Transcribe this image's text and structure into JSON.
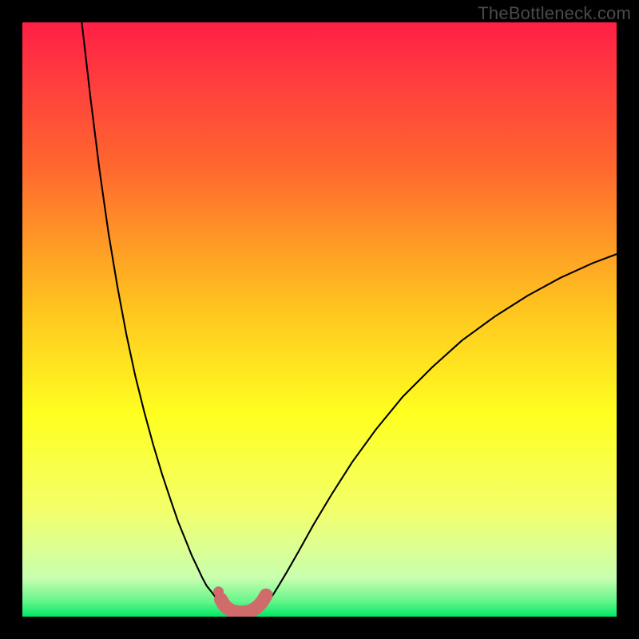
{
  "watermark": "TheBottleneck.com",
  "chart_data": {
    "type": "line",
    "title": "",
    "xlabel": "",
    "ylabel": "",
    "xlim": [
      0,
      100
    ],
    "ylim": [
      0,
      100
    ],
    "gradient_stops": [
      {
        "offset": 0.0,
        "color": "#ff1f47"
      },
      {
        "offset": 0.25,
        "color": "#ff6a2e"
      },
      {
        "offset": 0.48,
        "color": "#ffc41f"
      },
      {
        "offset": 0.66,
        "color": "#ffff20"
      },
      {
        "offset": 0.82,
        "color": "#f3ff6a"
      },
      {
        "offset": 0.935,
        "color": "#c9ffb0"
      },
      {
        "offset": 0.975,
        "color": "#63f58a"
      },
      {
        "offset": 1.0,
        "color": "#00e765"
      }
    ],
    "series": [
      {
        "name": "left-curve",
        "comment": "thin black curve descending from top-left into the valley",
        "x": [
          10.0,
          11.5,
          13.0,
          14.5,
          16.0,
          17.5,
          19.0,
          20.5,
          22.0,
          23.5,
          25.0,
          26.2,
          27.5,
          28.5,
          29.5,
          30.3,
          31.0,
          31.8,
          32.5,
          33.2,
          33.8,
          34.2
        ],
        "y": [
          100.0,
          87.0,
          75.0,
          64.5,
          55.5,
          47.5,
          40.5,
          34.5,
          29.0,
          24.0,
          19.5,
          16.0,
          12.8,
          10.3,
          8.2,
          6.5,
          5.2,
          4.2,
          3.3,
          2.6,
          2.1,
          1.7
        ]
      },
      {
        "name": "right-curve",
        "comment": "thin black curve ascending from valley toward top-right",
        "x": [
          40.5,
          41.0,
          42.0,
          43.0,
          44.5,
          46.5,
          49.0,
          52.0,
          55.5,
          59.5,
          64.0,
          69.0,
          74.0,
          79.5,
          85.0,
          90.5,
          96.0,
          100.0
        ],
        "y": [
          1.7,
          2.3,
          3.4,
          5.0,
          7.5,
          11.0,
          15.5,
          20.5,
          26.0,
          31.5,
          37.0,
          42.0,
          46.5,
          50.5,
          54.0,
          57.0,
          59.5,
          61.0
        ]
      },
      {
        "name": "valley-highlight",
        "comment": "thick salmon highlight at the bottom of the V",
        "x": [
          33.4,
          33.8,
          34.3,
          34.9,
          35.6,
          36.4,
          37.3,
          38.1,
          38.8,
          39.5,
          40.1,
          40.6,
          41.0
        ],
        "y": [
          2.9,
          2.2,
          1.6,
          1.15,
          0.85,
          0.72,
          0.72,
          0.85,
          1.15,
          1.6,
          2.2,
          2.9,
          3.6
        ]
      },
      {
        "name": "upper-dot",
        "comment": "small salmon dot slightly above left end of highlight",
        "x": [
          33.0
        ],
        "y": [
          4.2
        ]
      }
    ]
  }
}
